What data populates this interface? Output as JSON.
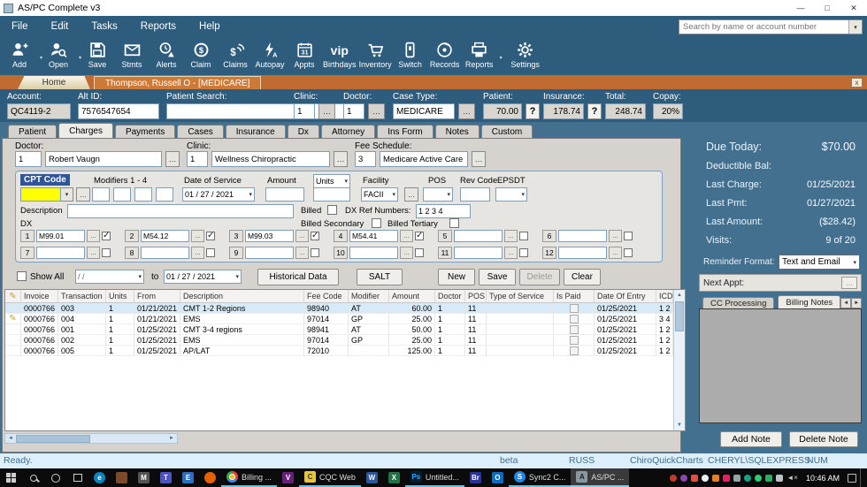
{
  "window": {
    "title": "AS/PC Complete v3",
    "minimize": "—",
    "maximize": "□",
    "close": "✕"
  },
  "menu": {
    "items": [
      "File",
      "Edit",
      "Tasks",
      "Reports",
      "Help"
    ]
  },
  "search": {
    "placeholder": "Search by name or account number"
  },
  "toolbar": {
    "items": [
      {
        "label": "Add"
      },
      {
        "label": "Open"
      },
      {
        "label": "Save"
      },
      {
        "label": "Stmts"
      },
      {
        "label": "Alerts"
      },
      {
        "label": "Claim"
      },
      {
        "label": "Claims"
      },
      {
        "label": "Autopay"
      },
      {
        "label": "Appts"
      },
      {
        "label": "Birthdays"
      },
      {
        "label": "Inventory"
      },
      {
        "label": "Switch"
      },
      {
        "label": "Records"
      },
      {
        "label": "Reports"
      },
      {
        "label": "Settings"
      }
    ],
    "vip_glyph": "vip"
  },
  "doc_tabs": {
    "home": "Home",
    "active": "Thompson, Russell O - [MEDICARE]",
    "close": "x"
  },
  "account_bar": {
    "account_label": "Account:",
    "account_value": "QC4119-2",
    "alt_label": "Alt ID:",
    "alt_value": "7576547654",
    "psearch_label": "Patient Search:",
    "clinic_label": "Clinic:",
    "clinic_value": "1",
    "doctor_label": "Doctor:",
    "doctor_value": "1",
    "case_label": "Case Type:",
    "case_value": "MEDICARE",
    "patient_label": "Patient:",
    "patient_value": "70.00",
    "ins_label": "Insurance:",
    "ins_value": "178.74",
    "total_label": "Total:",
    "total_value": "248.74",
    "copay_label": "Copay:",
    "copay_value": "20%",
    "dots": "…",
    "help": "?"
  },
  "patient_tabs": {
    "items": [
      "Patient",
      "Charges",
      "Payments",
      "Cases",
      "Insurance",
      "Dx",
      "Attorney",
      "Ins Form",
      "Notes",
      "Custom"
    ],
    "active": "Charges"
  },
  "charge_form": {
    "doctor_label": "Doctor:",
    "doctor_num": "1",
    "doctor_name": "Robert Vaugn",
    "clinic_label": "Clinic:",
    "clinic_num": "1",
    "clinic_name": "Wellness Chiropractic",
    "fee_label": "Fee Schedule:",
    "fee_num": "3",
    "fee_name": "Medicare Active Care",
    "cpt_label": "CPT Code",
    "modifiers_label": "Modifiers 1 - 4",
    "dos_label": "Date of Service",
    "dos_value": "01 / 27 / 2021",
    "amount_label": "Amount",
    "units_label": "Units",
    "facility_label": "Facility",
    "facility_value": "FACII",
    "pos_label": "POS",
    "revcode_label": "Rev Code",
    "epsdt_label": "EPSDT",
    "description_label": "Description",
    "billed_label": "Billed",
    "dxref_label": "DX Ref Numbers:",
    "dxref_value": "1 2 3 4",
    "billed_secondary_label": "Billed Secondary",
    "billed_tertiary_label": "Billed Tertiary",
    "dx_label": "DX",
    "dx_entries": [
      {
        "n": "1",
        "code": "M99.01",
        "checked": true
      },
      {
        "n": "2",
        "code": "M54.12",
        "checked": true
      },
      {
        "n": "3",
        "code": "M99.03",
        "checked": true
      },
      {
        "n": "4",
        "code": "M54.41",
        "checked": true
      },
      {
        "n": "5",
        "code": "",
        "checked": false
      },
      {
        "n": "6",
        "code": "",
        "checked": false
      },
      {
        "n": "7",
        "code": "",
        "checked": false
      },
      {
        "n": "8",
        "code": "",
        "checked": false
      },
      {
        "n": "9",
        "code": "",
        "checked": false
      },
      {
        "n": "10",
        "code": "",
        "checked": false
      },
      {
        "n": "11",
        "code": "",
        "checked": false
      },
      {
        "n": "12",
        "code": "",
        "checked": false
      }
    ]
  },
  "filter": {
    "show_all": "Show All",
    "from_value": "/    /",
    "to_label": "to",
    "to_value": "01 / 27 / 2021",
    "historical": "Historical Data",
    "salt": "SALT",
    "new": "New",
    "save": "Save",
    "delete": "Delete",
    "clear": "Clear"
  },
  "grid": {
    "columns": [
      "Invoice",
      "Transaction",
      "Units",
      "From",
      "Description",
      "Fee Code",
      "Modifier",
      "Amount",
      "Doctor",
      "POS",
      "Type of Service",
      "Is Paid",
      "Date Of Entry",
      "ICD"
    ],
    "rows": [
      {
        "invoice": "0000766",
        "transaction": "003",
        "units": "1",
        "from": "01/21/2021",
        "description": "CMT 1-2 Regions",
        "fee_code": "98940",
        "modifier": "AT",
        "amount": "60.00",
        "doctor": "1",
        "pos": "11",
        "type_of_service": "",
        "is_paid": false,
        "date_of_entry": "01/25/2021",
        "icd": "1 2",
        "selected": true
      },
      {
        "invoice": "0000766",
        "transaction": "004",
        "units": "1",
        "from": "01/21/2021",
        "description": "EMS",
        "fee_code": "97014",
        "modifier": "GP",
        "amount": "25.00",
        "doctor": "1",
        "pos": "11",
        "type_of_service": "",
        "is_paid": false,
        "date_of_entry": "01/25/2021",
        "icd": "3 4",
        "editing": true
      },
      {
        "invoice": "0000766",
        "transaction": "001",
        "units": "1",
        "from": "01/25/2021",
        "description": "CMT 3-4 regions",
        "fee_code": "98941",
        "modifier": "AT",
        "amount": "50.00",
        "doctor": "1",
        "pos": "11",
        "type_of_service": "",
        "is_paid": false,
        "date_of_entry": "01/25/2021",
        "icd": "1 2"
      },
      {
        "invoice": "0000766",
        "transaction": "002",
        "units": "1",
        "from": "01/25/2021",
        "description": "EMS",
        "fee_code": "97014",
        "modifier": "GP",
        "amount": "25.00",
        "doctor": "1",
        "pos": "11",
        "type_of_service": "",
        "is_paid": false,
        "date_of_entry": "01/25/2021",
        "icd": "1 2"
      },
      {
        "invoice": "0000766",
        "transaction": "005",
        "units": "1",
        "from": "01/25/2021",
        "description": "AP/LAT",
        "fee_code": "72010",
        "modifier": "",
        "amount": "125.00",
        "doctor": "1",
        "pos": "11",
        "type_of_service": "",
        "is_paid": false,
        "date_of_entry": "01/25/2021",
        "icd": "1 2"
      }
    ]
  },
  "right_panel": {
    "due_label": "Due Today:",
    "due_value": "$70.00",
    "deduct_label": "Deductible Bal:",
    "deduct_value": "",
    "last_charge_label": "Last Charge:",
    "last_charge_value": "01/25/2021",
    "last_pmt_label": "Last Pmt:",
    "last_pmt_value": "01/27/2021",
    "last_amount_label": "Last Amount:",
    "last_amount_value": "($28.42)",
    "visits_label": "Visits:",
    "visits_value": "9 of  20",
    "reminder_label": "Reminder Format:",
    "reminder_value": "Text and Email",
    "next_appt_label": "Next Appt:",
    "tab_cc": "CC Processing",
    "tab_notes": "Billing Notes",
    "add_note": "Add Note",
    "delete_note": "Delete Note"
  },
  "status": {
    "ready": "Ready.",
    "beta": "beta",
    "user": "RUSS",
    "app": "ChiroQuickCharts",
    "server": "CHERYL\\SQLEXPRESS",
    "num": "NUM"
  },
  "taskbar": {
    "clock": "10:46 AM",
    "apps": {
      "billing": "Billing ...",
      "cqc": "CQC Web",
      "ps": "Untitled...",
      "sync": "Sync2 C...",
      "aspc": "AS/PC ..."
    },
    "icon_text": {
      "edge": "e",
      "word": "W",
      "excel": "X",
      "ps": "Ps",
      "br": "Br",
      "outlook": "O",
      "vs": "V",
      "store": "S",
      "teams": "T",
      "mail": "M",
      "firefox": "F",
      "files": "E",
      "cqc": "C",
      "sync": "S",
      "aspc": "A"
    }
  }
}
